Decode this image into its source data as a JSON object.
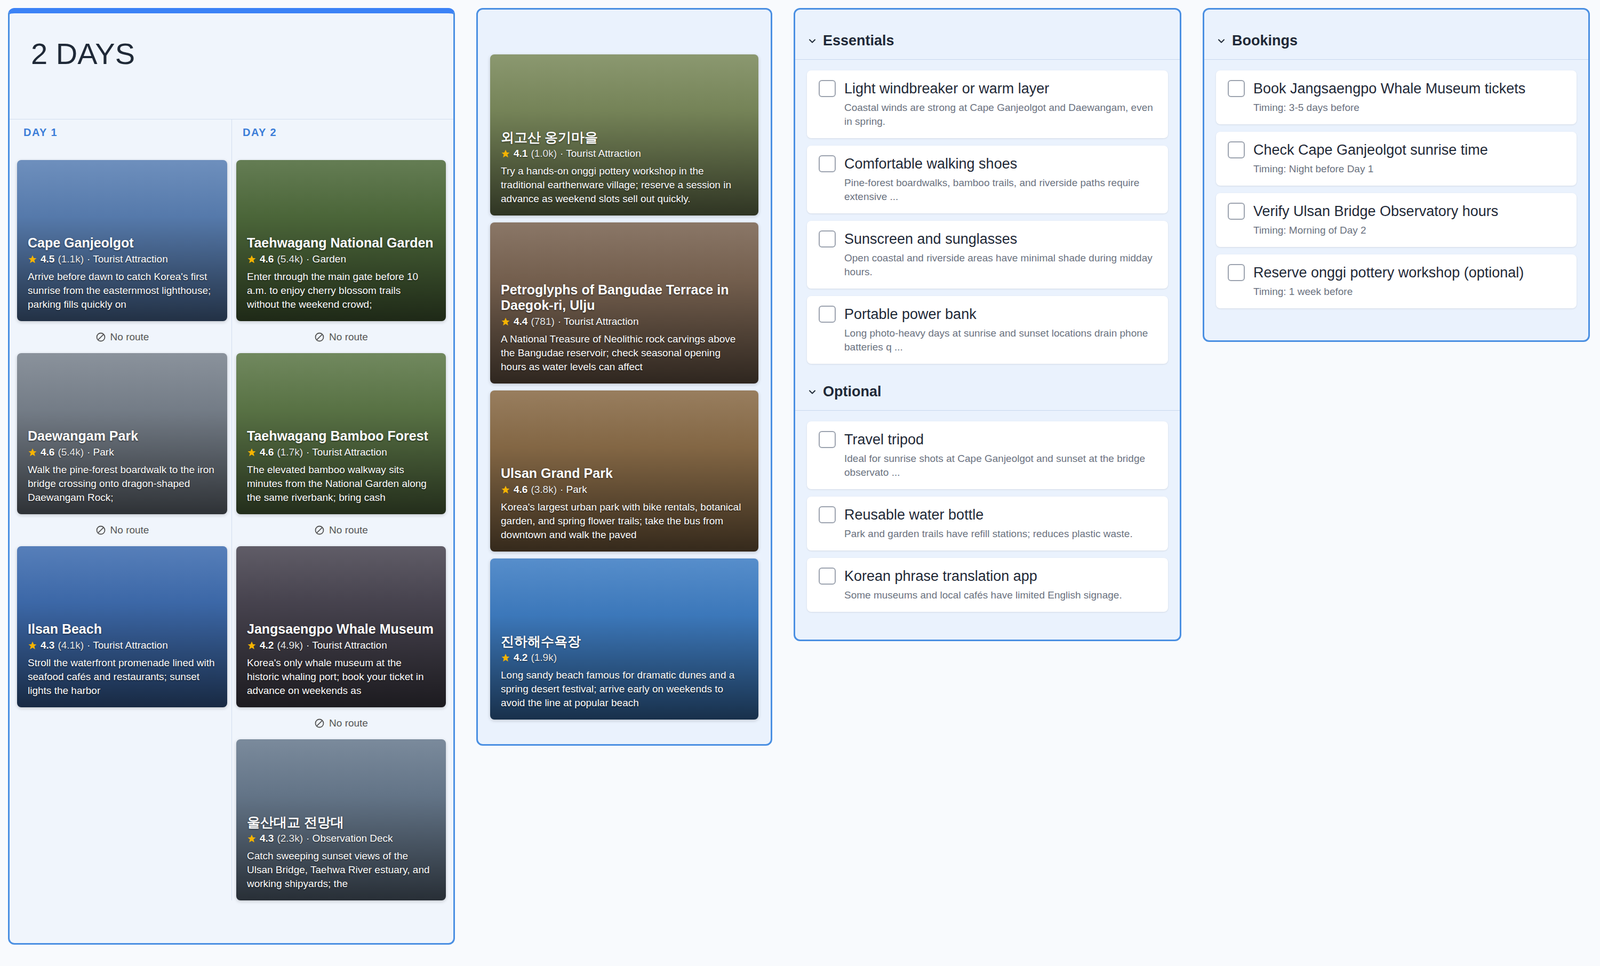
{
  "itinerary": {
    "title": "2 DAYS",
    "days": [
      {
        "label": "DAY 1",
        "stops": [
          {
            "name": "Cape Ganjeolgot",
            "rating": "4.5",
            "reviews": "(1.1k)",
            "category": "· Tourist Attraction",
            "description": "Arrive before dawn to catch Korea's first sunrise from the easternmost lighthouse; parking fills quickly on",
            "color": "#5a80b4",
            "route": "No route"
          },
          {
            "name": "Daewangam Park",
            "rating": "4.6",
            "reviews": "(5.4k)",
            "category": "· Park",
            "description": "Walk the pine-forest boardwalk to the iron bridge crossing onto dragon-shaped Daewangam Rock;",
            "color": "#7a838e",
            "route": "No route"
          },
          {
            "name": "Ilsan Beach",
            "rating": "4.3",
            "reviews": "(4.1k)",
            "category": "· Tourist Attraction",
            "description": "Stroll the waterfront promenade lined with seafood cafés and restaurants; sunset lights the harbor",
            "color": "#3f6db0",
            "route": ""
          }
        ]
      },
      {
        "label": "DAY 2",
        "stops": [
          {
            "name": "Taehwagang National Garden",
            "rating": "4.6",
            "reviews": "(5.4k)",
            "category": "· Garden",
            "description": "Enter through the main gate before 10 a.m. to enjoy cherry blossom trails without the weekend crowd;",
            "color": "#4f6b3c",
            "route": "No route"
          },
          {
            "name": "Taehwagang Bamboo Forest",
            "rating": "4.6",
            "reviews": "(1.7k)",
            "category": "· Tourist Attraction",
            "description": "The elevated bamboo walkway sits minutes from the National Garden along the same riverbank; bring cash",
            "color": "#5d7848",
            "route": "No route"
          },
          {
            "name": "Jangsaengpo Whale Museum",
            "rating": "4.2",
            "reviews": "(4.9k)",
            "category": "· Tourist Attraction",
            "description": "Korea's only whale museum at the historic whaling port; book your ticket in advance on weekends as",
            "color": "#4a4652",
            "route": "No route"
          },
          {
            "name": "울산대교 전망대",
            "rating": "4.3",
            "reviews": "(2.3k)",
            "category": "· Observation Deck",
            "description": "Catch sweeping sunset views of the Ulsan Bridge, Taehwa River estuary, and working shipyards; the",
            "color": "#687a8e",
            "route": ""
          }
        ]
      }
    ]
  },
  "unscheduled": {
    "stops": [
      {
        "name": "외고산 옹기마을",
        "rating": "4.1",
        "reviews": "(1.0k)",
        "category": "· Tourist Attraction",
        "description": "Try a hands-on onggi pottery workshop in the traditional earthenware village; reserve a session in advance as weekend slots sell out quickly.",
        "color": "#7b8a5c"
      },
      {
        "name": "Petroglyphs of Bangudae Terrace in Daegok-ri, Ulju",
        "rating": "4.4",
        "reviews": "(781)",
        "category": "· Tourist Attraction",
        "description": "A National Treasure of Neolithic rock carvings above the Bangudae reservoir; check seasonal opening hours as water levels can affect",
        "color": "#7a6452"
      },
      {
        "name": "Ulsan Grand Park",
        "rating": "4.6",
        "reviews": "(3.8k)",
        "category": "· Park",
        "description": "Korea's largest urban park with bike rentals, botanical garden, and spring flower trails; take the bus from downtown and walk the paved",
        "color": "#8a6c48"
      },
      {
        "name": "진하해수욕장",
        "rating": "4.2",
        "reviews": "(1.9k)",
        "category": "",
        "description": "Long sandy beach famous for dramatic dunes and a spring desert festival; arrive early on weekends to avoid the line at popular beach",
        "color": "#3f7ec4"
      }
    ]
  },
  "checklist": {
    "sections": [
      {
        "title": "Essentials",
        "expanded": true,
        "items": [
          {
            "label": "Light windbreaker or warm layer",
            "note": "Coastal winds are strong at Cape Ganjeolgot and Daewangam, even in spring.",
            "checked": false
          },
          {
            "label": "Comfortable walking shoes",
            "note": "Pine-forest boardwalks, bamboo trails, and riverside paths require extensive ...",
            "checked": false
          },
          {
            "label": "Sunscreen and sunglasses",
            "note": "Open coastal and riverside areas have minimal shade during midday hours.",
            "checked": false
          },
          {
            "label": "Portable power bank",
            "note": "Long photo-heavy days at sunrise and sunset locations drain phone batteries q ...",
            "checked": false
          }
        ]
      },
      {
        "title": "Optional",
        "expanded": true,
        "items": [
          {
            "label": "Travel tripod",
            "note": "Ideal for sunrise shots at Cape Ganjeolgot and sunset at the bridge observato ...",
            "checked": false
          },
          {
            "label": "Reusable water bottle",
            "note": "Park and garden trails have refill stations; reduces plastic waste.",
            "checked": false
          },
          {
            "label": "Korean phrase translation app",
            "note": "Some museums and local cafés have limited English signage.",
            "checked": false
          }
        ]
      }
    ]
  },
  "bookings": {
    "sections": [
      {
        "title": "Bookings",
        "expanded": true,
        "items": [
          {
            "label": "Book Jangsaengpo Whale Museum tickets",
            "note": "Timing: 3-5 days before",
            "checked": false
          },
          {
            "label": "Check Cape Ganjeolgot sunrise time",
            "note": "Timing: Night before Day 1",
            "checked": false
          },
          {
            "label": "Verify Ulsan Bridge Observatory hours",
            "note": "Timing: Morning of Day 2",
            "checked": false
          },
          {
            "label": "Reserve onggi pottery workshop (optional)",
            "note": "Timing: 1 week before",
            "checked": false
          }
        ]
      }
    ]
  }
}
